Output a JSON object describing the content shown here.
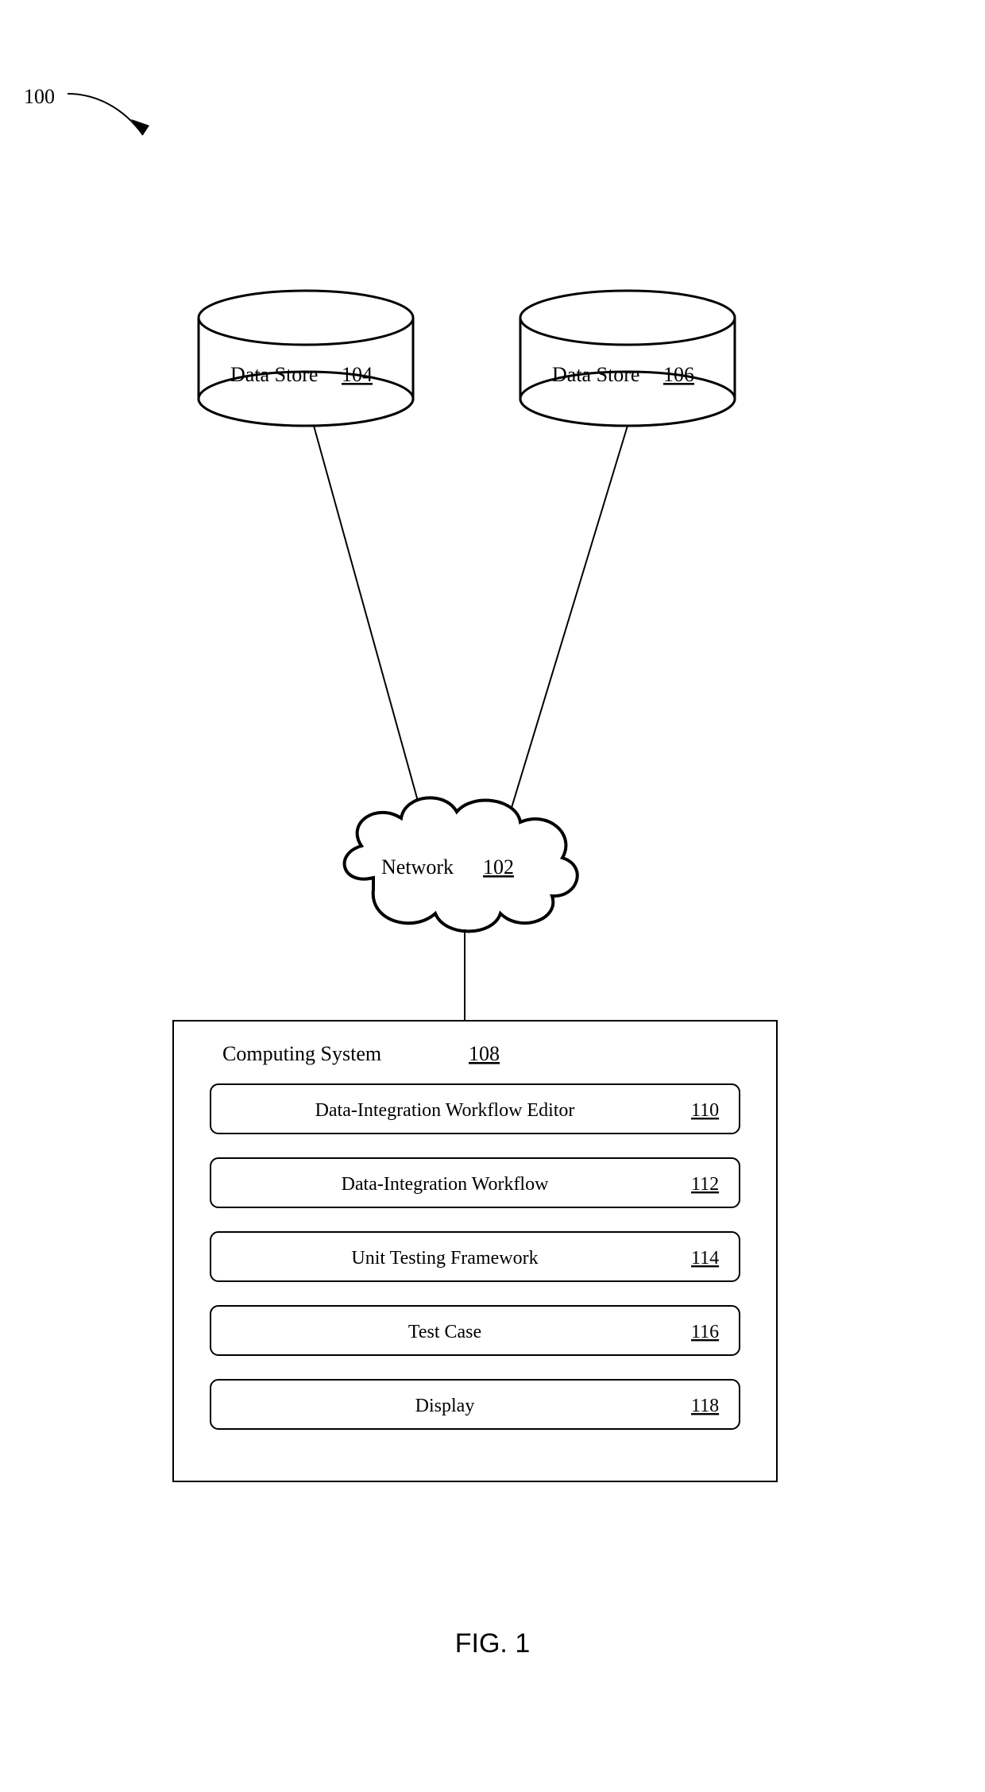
{
  "figure": {
    "id": "100",
    "caption": "FIG. 1"
  },
  "dataStores": [
    {
      "label": "Data Store",
      "ref": "104"
    },
    {
      "label": "Data Store",
      "ref": "106"
    }
  ],
  "network": {
    "label": "Network",
    "ref": "102"
  },
  "computing": {
    "label": "Computing System",
    "ref": "108",
    "rows": [
      {
        "label": "Data-Integration Workflow Editor",
        "ref": "110"
      },
      {
        "label": "Data-Integration Workflow",
        "ref": "112"
      },
      {
        "label": "Unit Testing Framework",
        "ref": "114"
      },
      {
        "label": "Test Case",
        "ref": "116"
      },
      {
        "label": "Display",
        "ref": "118"
      }
    ]
  }
}
